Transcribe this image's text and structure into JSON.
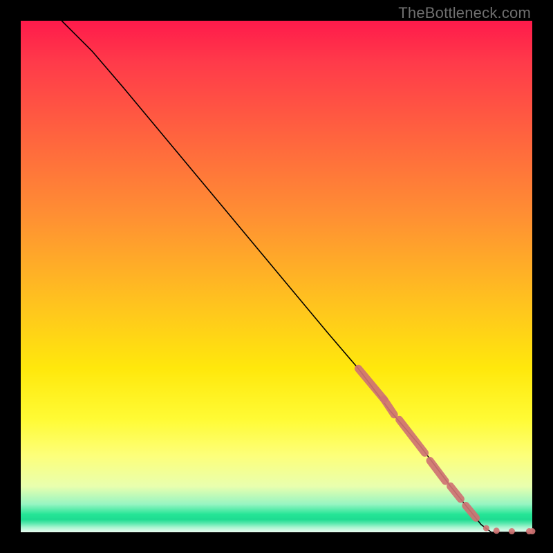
{
  "watermark": "TheBottleneck.com",
  "colors": {
    "marker": "#cf7373",
    "line": "#000000"
  },
  "chart_data": {
    "type": "line",
    "title": "",
    "xlabel": "",
    "ylabel": "",
    "xlim": [
      0,
      100
    ],
    "ylim": [
      0,
      100
    ],
    "grid": false,
    "curve_notes": "Monotone decreasing curve starting at top-left (x≈8,y=100), gentle convex start, then near-linear descent to (≈92,0), then flat along y=0 to x=100",
    "curve": [
      {
        "x": 8,
        "y": 100
      },
      {
        "x": 10,
        "y": 98
      },
      {
        "x": 14,
        "y": 94
      },
      {
        "x": 20,
        "y": 87
      },
      {
        "x": 30,
        "y": 75
      },
      {
        "x": 40,
        "y": 63
      },
      {
        "x": 50,
        "y": 51
      },
      {
        "x": 60,
        "y": 39
      },
      {
        "x": 66,
        "y": 32
      },
      {
        "x": 72,
        "y": 24
      },
      {
        "x": 78,
        "y": 17
      },
      {
        "x": 84,
        "y": 9
      },
      {
        "x": 88,
        "y": 4
      },
      {
        "x": 90,
        "y": 1.5
      },
      {
        "x": 92,
        "y": 0
      },
      {
        "x": 96,
        "y": 0
      },
      {
        "x": 100,
        "y": 0
      }
    ],
    "marker_clusters_notes": "Thick salmon-colored stroke over a segment of the descending line (≈x 66→90), plus discrete dots along the flat tail",
    "marker_thick_segments": [
      {
        "x1": 66,
        "y1": 32,
        "x2": 71,
        "y2": 26
      },
      {
        "x1": 71,
        "y1": 26,
        "x2": 73,
        "y2": 23
      },
      {
        "x1": 74,
        "y1": 22,
        "x2": 79,
        "y2": 15.5
      },
      {
        "x1": 80,
        "y1": 14,
        "x2": 83,
        "y2": 10
      },
      {
        "x1": 84,
        "y1": 9,
        "x2": 86,
        "y2": 6.5
      },
      {
        "x1": 87,
        "y1": 5.2,
        "x2": 89,
        "y2": 2.8
      }
    ],
    "marker_dots": [
      {
        "x": 91,
        "y": 0.8,
        "r": 4.5
      },
      {
        "x": 93,
        "y": 0.3,
        "r": 4.5
      },
      {
        "x": 96,
        "y": 0.2,
        "r": 4.5
      },
      {
        "x": 99.4,
        "y": 0.2,
        "r": 4.5
      },
      {
        "x": 100,
        "y": 0.2,
        "r": 4.5
      }
    ]
  }
}
